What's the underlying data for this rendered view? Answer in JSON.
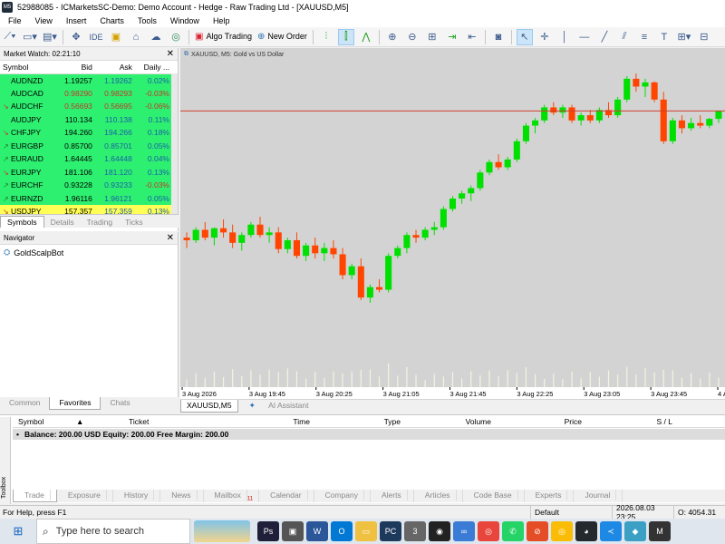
{
  "window": {
    "title": "52988085 - ICMarketsSC-Demo: Demo Account - Hedge - Raw Trading Ltd - [XAUUSD,M5]"
  },
  "menu": [
    "File",
    "View",
    "Insert",
    "Charts",
    "Tools",
    "Window",
    "Help"
  ],
  "toolbar": {
    "algo_trading": "Algo Trading",
    "new_order": "New Order",
    "ide": "IDE"
  },
  "market_watch": {
    "title": "Market Watch: 02:21:10",
    "headers": {
      "symbol": "Symbol",
      "bid": "Bid",
      "ask": "Ask",
      "daily": "Daily ..."
    },
    "rows": [
      {
        "symbol": "AUDNZD",
        "bid": "1.19257",
        "ask": "1.19262",
        "daily": "0.02%",
        "dir": "none",
        "bg": "#2ef070"
      },
      {
        "symbol": "AUDCAD",
        "bid": "0.98290",
        "ask": "0.98293",
        "daily": "-0.03%",
        "dir": "none",
        "bg": "#2ef070"
      },
      {
        "symbol": "AUDCHF",
        "bid": "0.56693",
        "ask": "0.56695",
        "daily": "-0.06%",
        "dir": "down",
        "bg": "#2ef070"
      },
      {
        "symbol": "AUDJPY",
        "bid": "110.134",
        "ask": "110.138",
        "daily": "0.11%",
        "dir": "none",
        "bg": "#2ef070"
      },
      {
        "symbol": "CHFJPY",
        "bid": "194.260",
        "ask": "194.266",
        "daily": "0.18%",
        "dir": "down",
        "bg": "#2ef070"
      },
      {
        "symbol": "EURGBP",
        "bid": "0.85700",
        "ask": "0.85701",
        "daily": "0.05%",
        "dir": "up",
        "bg": "#2ef070"
      },
      {
        "symbol": "EURAUD",
        "bid": "1.64445",
        "ask": "1.64448",
        "daily": "0.04%",
        "dir": "up",
        "bg": "#2ef070"
      },
      {
        "symbol": "EURJPY",
        "bid": "181.106",
        "ask": "181.120",
        "daily": "0.13%",
        "dir": "down",
        "bg": "#2ef070"
      },
      {
        "symbol": "EURCHF",
        "bid": "0.93228",
        "ask": "0.93233",
        "daily": "-0.03%",
        "dir": "up",
        "bg": "#2ef070"
      },
      {
        "symbol": "EURNZD",
        "bid": "1.96116",
        "ask": "1.96121",
        "daily": "0.05%",
        "dir": "up",
        "bg": "#2ef070"
      },
      {
        "symbol": "USDJPY",
        "bid": "157.357",
        "ask": "157.359",
        "daily": "0.13%",
        "dir": "down",
        "bg": "#ffff55"
      }
    ],
    "tabs": [
      "Symbols",
      "Details",
      "Trading",
      "Ticks"
    ]
  },
  "navigator": {
    "title": "Navigator",
    "items": [
      "GoldScalpBot"
    ],
    "tabs": [
      "Common",
      "Favorites",
      "Chats"
    ]
  },
  "chart": {
    "label": "XAUUSD, M5:  Gold vs US Dollar",
    "time_labels": [
      "3 Aug 2026",
      "3 Aug 19:45",
      "3 Aug 20:25",
      "3 Aug 21:05",
      "3 Aug 21:45",
      "3 Aug 22:25",
      "3 Aug 23:05",
      "3 Aug 23:45",
      "4 Aug 01:2"
    ],
    "tabs": [
      "XAUUSD,M5",
      "AI Assistant"
    ],
    "bull_color": "#00e000",
    "bear_color": "#ff4500",
    "bg_color": "#d3d3d3"
  },
  "chart_data": {
    "type": "candlestick",
    "symbol": "XAUUSD",
    "timeframe": "M5",
    "price_line": 4054.31,
    "ylim": [
      4010,
      4065
    ],
    "candles": [
      [
        4030,
        4031,
        4028,
        4029.5
      ],
      [
        4029.5,
        4032,
        4029,
        4031.5
      ],
      [
        4031.5,
        4033,
        4029.5,
        4030
      ],
      [
        4030,
        4032,
        4028.5,
        4031.8
      ],
      [
        4031.8,
        4033.5,
        4030,
        4031
      ],
      [
        4031,
        4032.5,
        4028,
        4029
      ],
      [
        4029,
        4031,
        4027.5,
        4030.5
      ],
      [
        4030.5,
        4033,
        4030,
        4032.5
      ],
      [
        4032.5,
        4034,
        4030,
        4030.5
      ],
      [
        4030.5,
        4032,
        4029,
        4031
      ],
      [
        4031,
        4032,
        4027,
        4027.8
      ],
      [
        4027.8,
        4030,
        4027,
        4029.5
      ],
      [
        4029.5,
        4031,
        4026,
        4026.5
      ],
      [
        4026.5,
        4029,
        4025.5,
        4028.5
      ],
      [
        4028.5,
        4030,
        4026,
        4027
      ],
      [
        4027,
        4029,
        4025.5,
        4028
      ],
      [
        4028,
        4029.5,
        4026,
        4026.8
      ],
      [
        4026.8,
        4028,
        4022,
        4022.8
      ],
      [
        4022.8,
        4025,
        4022,
        4024.5
      ],
      [
        4024.5,
        4026,
        4018,
        4018.5
      ],
      [
        4018.5,
        4021,
        4017.5,
        4020.5
      ],
      [
        4020.5,
        4022,
        4019.5,
        4020
      ],
      [
        4020,
        4027,
        4019.5,
        4026.5
      ],
      [
        4026.5,
        4028.5,
        4026,
        4028
      ],
      [
        4028,
        4031,
        4027,
        4030.5
      ],
      [
        4030.5,
        4031.5,
        4029,
        4030
      ],
      [
        4030,
        4032,
        4029.5,
        4031.5
      ],
      [
        4031.5,
        4033,
        4030.5,
        4032
      ],
      [
        4032,
        4036,
        4031.5,
        4035.5
      ],
      [
        4035.5,
        4038,
        4035,
        4037.5
      ],
      [
        4037.5,
        4039,
        4036.5,
        4038.5
      ],
      [
        4038.5,
        4040,
        4037,
        4039.5
      ],
      [
        4039.5,
        4043,
        4039,
        4042.5
      ],
      [
        4042.5,
        4045,
        4042,
        4044.5
      ],
      [
        4044.5,
        4046,
        4043,
        4043.5
      ],
      [
        4043.5,
        4045.5,
        4043,
        4045
      ],
      [
        4045,
        4049,
        4044.5,
        4048.5
      ],
      [
        4048.5,
        4052,
        4048,
        4051.5
      ],
      [
        4051.5,
        4053,
        4050,
        4052.5
      ],
      [
        4052.5,
        4055.5,
        4052,
        4055
      ],
      [
        4055,
        4056,
        4053.5,
        4054
      ],
      [
        4054,
        4055.5,
        4053,
        4055
      ],
      [
        4055,
        4055.5,
        4052,
        4052.5
      ],
      [
        4052.5,
        4054,
        4051.5,
        4053.5
      ],
      [
        4053.5,
        4054.5,
        4052,
        4052.5
      ],
      [
        4052.5,
        4055,
        4052,
        4054.5
      ],
      [
        4054.5,
        4056,
        4053,
        4053.5
      ],
      [
        4053.5,
        4057,
        4053,
        4056.5
      ],
      [
        4056.5,
        4061,
        4056,
        4060.5
      ],
      [
        4060.5,
        4061.5,
        4058,
        4059
      ],
      [
        4059,
        4060.5,
        4057,
        4059.8
      ],
      [
        4059.8,
        4060,
        4056,
        4056.5
      ],
      [
        4056.5,
        4058,
        4048,
        4048.5
      ],
      [
        4048.5,
        4053,
        4048,
        4052.5
      ],
      [
        4052.5,
        4053.5,
        4050,
        4051
      ],
      [
        4051,
        4053,
        4050.5,
        4052
      ],
      [
        4052,
        4053.5,
        4051,
        4051.5
      ],
      [
        4051.5,
        4053,
        4051,
        4052.8
      ],
      [
        4052.8,
        4054.3,
        4052,
        4054.3
      ]
    ],
    "volumes_note": "volume histogram at bottom"
  },
  "toolbox": {
    "headers": [
      "Symbol",
      "Ticket",
      "Time",
      "Type",
      "Volume",
      "Price",
      "S / L"
    ],
    "balance": "Balance: 200.00 USD  Equity: 200.00  Free Margin: 200.00",
    "side_label": "Toolbox",
    "tabs": [
      {
        "label": "Trade",
        "badge": ""
      },
      {
        "label": "Exposure",
        "badge": ""
      },
      {
        "label": "History",
        "badge": ""
      },
      {
        "label": "News",
        "badge": ""
      },
      {
        "label": "Mailbox",
        "badge": "11"
      },
      {
        "label": "Calendar",
        "badge": ""
      },
      {
        "label": "Company",
        "badge": ""
      },
      {
        "label": "Alerts",
        "badge": ""
      },
      {
        "label": "Articles",
        "badge": ""
      },
      {
        "label": "Code Base",
        "badge": ""
      },
      {
        "label": "Experts",
        "badge": ""
      },
      {
        "label": "Journal",
        "badge": ""
      }
    ]
  },
  "status": {
    "help": "For Help, press F1",
    "profile": "Default",
    "time": "2026.08.03 23:25",
    "open": "O: 4054.31"
  },
  "taskbar": {
    "search_placeholder": "Type here to search",
    "badge": "3"
  }
}
